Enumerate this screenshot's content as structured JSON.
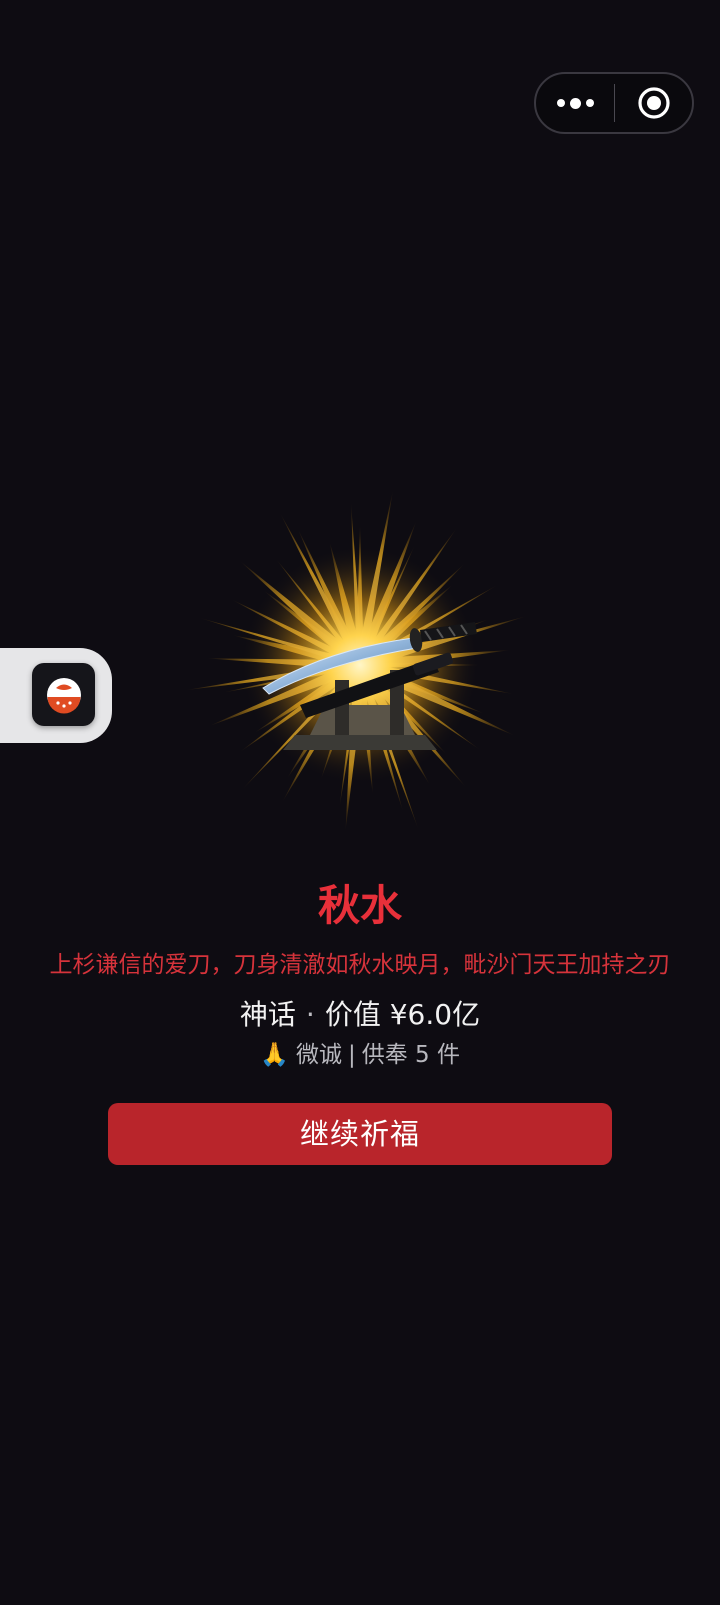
{
  "capsule": {
    "more_icon": "more-dots-icon",
    "close_icon": "target-close-icon"
  },
  "side_handle": {
    "icon": "app-logo-icon"
  },
  "item": {
    "image_icon": "katana-burst-image",
    "name": "秋水",
    "description": "上杉谦信的爱刀，刀身清澈如秋水映月，毗沙门天王加持之刃",
    "rarity": "神话",
    "separator": "·",
    "value_text": "价值 ¥6.0亿",
    "pray_emoji": "🙏",
    "donor_level": "微诚",
    "offer_sep": "|",
    "offer_text": "供奉 5 件"
  },
  "actions": {
    "continue_label": "继续祈福"
  },
  "colors": {
    "background": "#0e0c12",
    "accent_red": "#e8303a",
    "button_red": "#b9252b"
  }
}
